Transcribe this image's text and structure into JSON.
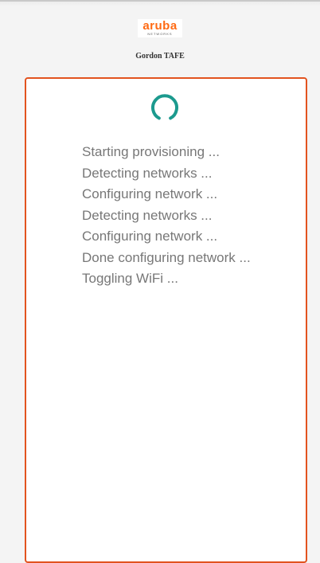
{
  "header": {
    "logo_word": "aruba",
    "logo_sub": "NETWORKS",
    "site_name": "Gordon TAFE"
  },
  "status": {
    "spinner_color": "#1c9a8e",
    "lines": [
      "Starting provisioning ...",
      "Detecting networks ...",
      "Configuring network ...",
      "Detecting networks ...",
      "Configuring network ...",
      "Done configuring network ...",
      "Toggling WiFi ..."
    ]
  },
  "colors": {
    "accent": "#e2531f",
    "brand": "#ff6a13"
  }
}
